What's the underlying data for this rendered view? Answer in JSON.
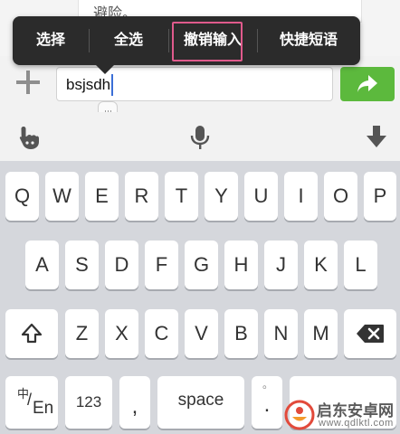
{
  "chat": {
    "partial_text": "避险。"
  },
  "context_menu": {
    "items": [
      {
        "label": "选择"
      },
      {
        "label": "全选"
      },
      {
        "label": "撤销输入"
      },
      {
        "label": "快捷短语"
      }
    ],
    "highlight_color": "#e05a8c"
  },
  "input_bar": {
    "plus_icon": "plus-icon",
    "text_value": "bsjsdh",
    "send_icon": "send-arrow-icon",
    "send_color": "#5cb93d"
  },
  "toolbar": {
    "icons": [
      "gesture-hand-icon",
      "microphone-icon",
      "hide-keyboard-icon"
    ]
  },
  "keyboard": {
    "row1": [
      "Q",
      "W",
      "E",
      "R",
      "T",
      "Y",
      "U",
      "I",
      "O",
      "P"
    ],
    "row2": [
      "A",
      "S",
      "D",
      "F",
      "G",
      "H",
      "J",
      "K",
      "L"
    ],
    "row3": [
      "Z",
      "X",
      "C",
      "V",
      "B",
      "N",
      "M"
    ],
    "shift_icon": "shift-icon",
    "backspace_icon": "backspace-icon",
    "lang_top": "中",
    "lang_bottom": "En",
    "numbers_label": "123",
    "comma_label": ",",
    "space_label": "space",
    "period_label": ".",
    "period_alt": "。"
  },
  "watermark": {
    "title": "启东安卓网",
    "url": "www.qdlktl.com"
  }
}
